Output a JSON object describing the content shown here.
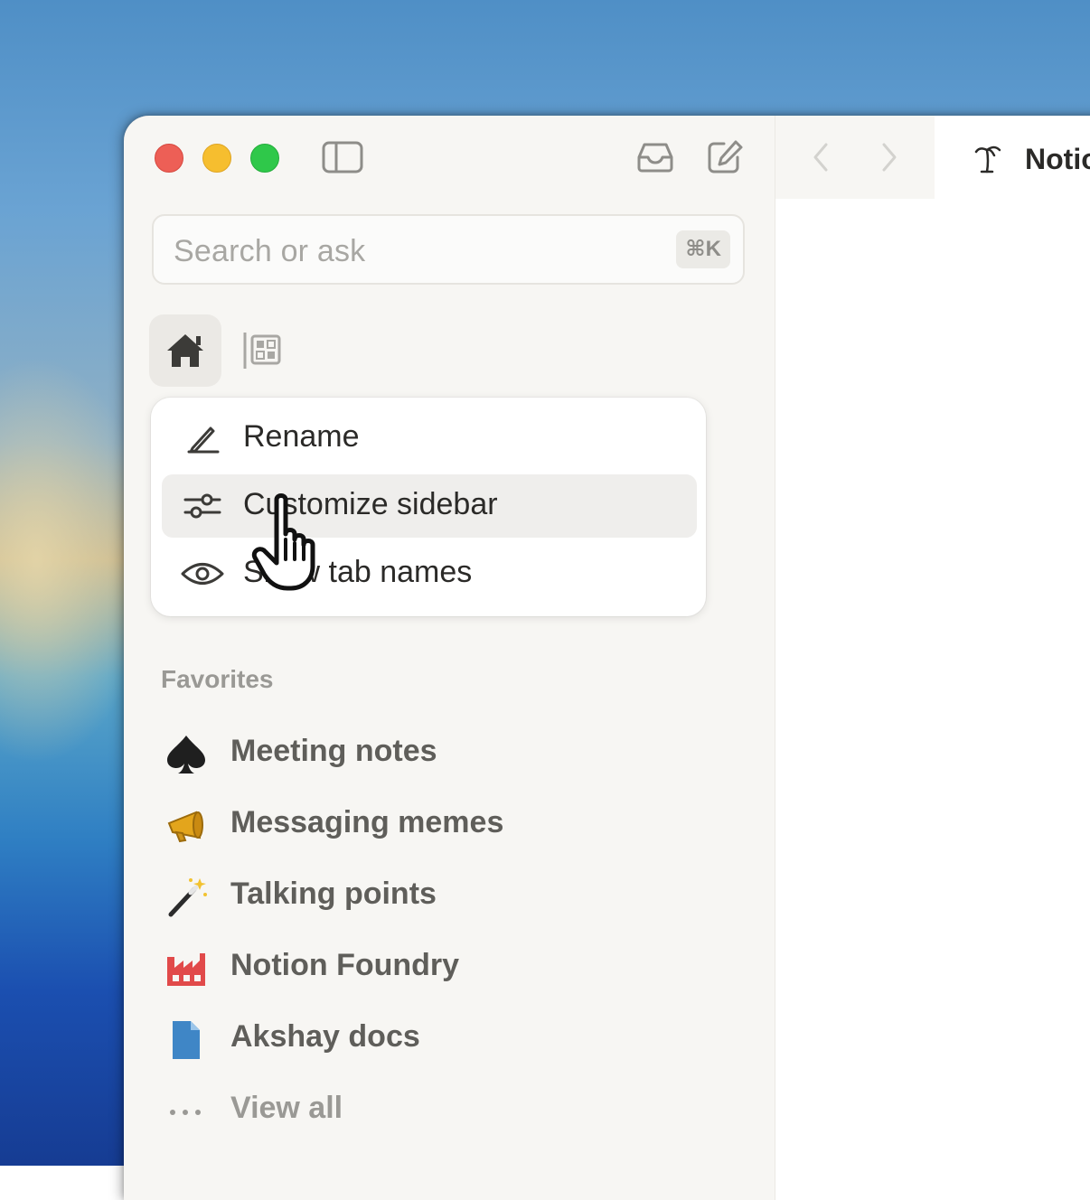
{
  "search": {
    "placeholder": "Search or ask",
    "shortcut": "⌘K"
  },
  "context_menu": {
    "items": [
      {
        "label": "Rename",
        "icon": "pencil-icon"
      },
      {
        "label": "Customize sidebar",
        "icon": "sliders-icon",
        "hovered": true
      },
      {
        "label": "Show tab names",
        "icon": "eye-icon"
      }
    ]
  },
  "favorites": {
    "title": "Favorites",
    "items": [
      {
        "label": "Meeting notes",
        "icon": "spade-icon"
      },
      {
        "label": "Messaging memes",
        "icon": "megaphone-icon"
      },
      {
        "label": "Talking points",
        "icon": "magic-wand-icon"
      },
      {
        "label": "Notion Foundry",
        "icon": "factory-icon"
      },
      {
        "label": "Akshay docs",
        "icon": "document-icon"
      }
    ],
    "view_all": "View all"
  },
  "tab": {
    "title": "Notion"
  },
  "colors": {
    "sidebar_bg": "#f7f6f3",
    "menu_hover": "#efeeec",
    "text_primary": "#2b2a28",
    "text_secondary": "#5f5e5a",
    "text_muted": "#9a9995",
    "traffic_red": "#ed5f56",
    "traffic_yellow": "#f6be2f",
    "traffic_green": "#2fc84a"
  }
}
